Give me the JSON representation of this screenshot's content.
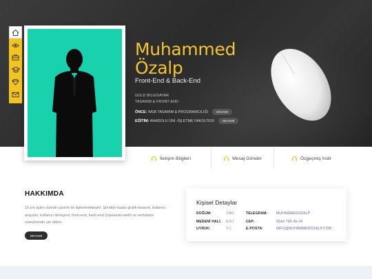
{
  "hero": {
    "name_line1": "Muhammed",
    "name_line2": "Özalp",
    "role": "Front-End & Back-End",
    "company": "GOLD BILGISAYAR",
    "company_role": "TASARIM & FRONT-END",
    "previous_label": "ÖNCE:",
    "previous_value": "WEB TASARIM & PROGRAMCILIĞI",
    "previous_button": "DEVAMI",
    "education_label": "EĞİTİM:",
    "education_value": "ANADOLU ÜNİ.-İŞLETME FAKÜLTESİ",
    "education_button": "DEVAMI"
  },
  "sidebar": {
    "icons": [
      "home-icon",
      "eye-icon",
      "briefcase-icon",
      "graduation-cap-icon",
      "diamond-icon",
      "envelope-icon"
    ]
  },
  "actions": [
    {
      "label": "İletişim Bilgileri",
      "icon": "headset-icon"
    },
    {
      "label": "Mesaj Gönder",
      "icon": "headset-icon"
    },
    {
      "label": "Özgeçmiş İndir",
      "icon": "headset-icon"
    }
  ],
  "about": {
    "title": "HAKKIMDA",
    "text": "10 yılı aşkın süredir yazılım ile ilgilenmekteyim. Şimdiye kadar grafik-tasarım, kullanıcı arayüzü, kullanıcı deneyimi, front-end, back-end (masaüstü-web) ve veritabanı süreçlerinde yer aldım.",
    "button": "DEVAMI"
  },
  "details": {
    "title": "Kişisel Detaylar",
    "birth_label": "DOĞUM:",
    "birth_value": "1981",
    "marital_label": "MEDENİ HALİ:",
    "marital_value": "EVLİ",
    "nationality_label": "UYRUK:",
    "nationality_value": "T.C.",
    "telegram_label": "TELEGRAM:",
    "telegram_value": "MUHAMMEDOZALP",
    "phone_label": "CEP:",
    "phone_value": "0542-765-46-24",
    "email_label": "E-POSTA:",
    "email_value": "INFO@MUHAMMEDOZALP.COM"
  },
  "colors": {
    "accent": "#f3c31f",
    "photo_bg": "#19d1ac",
    "hero_bg": "#2f2f2f",
    "link": "#6b58b5"
  }
}
